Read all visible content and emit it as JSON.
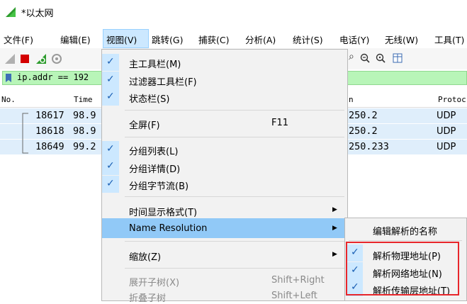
{
  "window": {
    "title": "*以太网"
  },
  "menubar": [
    "文件(F)",
    "编辑(E)",
    "视图(V)",
    "跳转(G)",
    "捕获(C)",
    "分析(A)",
    "统计(S)",
    "电话(Y)",
    "无线(W)",
    "工具(T)"
  ],
  "filter": {
    "value": "ip.addr == 192"
  },
  "packet_list": {
    "headers": [
      "No.",
      "Time",
      "n",
      "Protoc"
    ],
    "rows": [
      {
        "no": "18617",
        "time": "98.9",
        "dst": "250.2",
        "proto": "UDP"
      },
      {
        "no": "18618",
        "time": "98.9",
        "dst": "250.2",
        "proto": "UDP"
      },
      {
        "no": "18649",
        "time": "99.2",
        "dst": "250.233",
        "proto": "UDP"
      }
    ]
  },
  "view_menu": {
    "items": [
      {
        "label": "主工具栏(M)",
        "checked": true
      },
      {
        "label": "过滤器工具栏(F)",
        "checked": true
      },
      {
        "label": "状态栏(S)",
        "checked": true
      },
      {
        "label": "全屏(F)",
        "shortcut": "F11"
      },
      {
        "label": "分组列表(L)",
        "checked": true
      },
      {
        "label": "分组详情(D)",
        "checked": true
      },
      {
        "label": "分组字节流(B)",
        "checked": true
      },
      {
        "label": "时间显示格式(T)",
        "submenu": true
      },
      {
        "label": "Name Resolution",
        "submenu": true,
        "highlighted": true
      },
      {
        "label": "缩放(Z)",
        "submenu": true
      },
      {
        "label": "展开子树(X)",
        "shortcut": "Shift+Right",
        "disabled": true
      },
      {
        "label": "折叠子树",
        "shortcut": "Shift+Left",
        "disabled": true
      }
    ]
  },
  "name_resolution_submenu": {
    "items": [
      {
        "label": "编辑解析的名称"
      },
      {
        "label": "解析物理地址(P)",
        "checked": true
      },
      {
        "label": "解析网络地址(N)",
        "checked": true
      },
      {
        "label": "解析传输层地址(T)",
        "checked": true
      }
    ]
  },
  "colors": {
    "highlight": "#91c9f7",
    "check_bg": "#cce8ff",
    "filter_bg": "#b8f5b8",
    "annotation": "#e8262b"
  }
}
